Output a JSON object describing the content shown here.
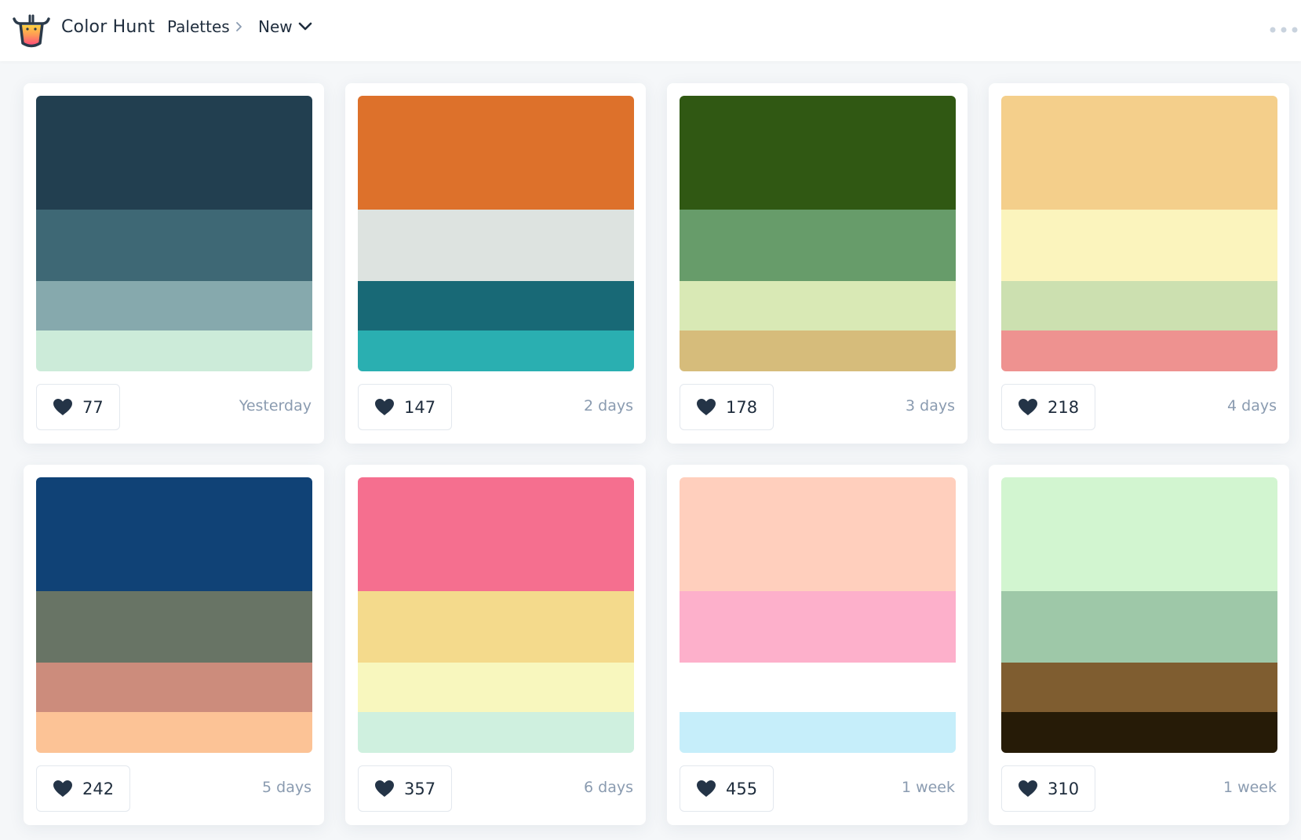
{
  "header": {
    "brand": "Color Hunt",
    "breadcrumb": "Palettes",
    "sort": "New"
  },
  "palettes": [
    {
      "colors": [
        "#223f50",
        "#3e6875",
        "#86a9ad",
        "#ccebd9"
      ],
      "likes": "77",
      "date": "Yesterday"
    },
    {
      "colors": [
        "#dd712b",
        "#dde3e0",
        "#186976",
        "#2aafb1"
      ],
      "likes": "147",
      "date": "2 days"
    },
    {
      "colors": [
        "#305813",
        "#679c6a",
        "#d9e9b5",
        "#d6bc7b"
      ],
      "likes": "178",
      "date": "3 days"
    },
    {
      "colors": [
        "#f4cf8b",
        "#fbf4bd",
        "#cce0b0",
        "#ee9290"
      ],
      "likes": "218",
      "date": "4 days"
    },
    {
      "colors": [
        "#104276",
        "#687465",
        "#cc8c7c",
        "#fcc396"
      ],
      "likes": "242",
      "date": "5 days"
    },
    {
      "colors": [
        "#f56f8f",
        "#f4da8c",
        "#f8f7be",
        "#cff0df"
      ],
      "likes": "357",
      "date": "6 days"
    },
    {
      "colors": [
        "#ffcfbd",
        "#fdb0cb",
        "#ffffff",
        "#c6eefa"
      ],
      "likes": "455",
      "date": "1 week"
    },
    {
      "colors": [
        "#d2f5d0",
        "#9ec8a8",
        "#7f5d30",
        "#261b07"
      ],
      "likes": "310",
      "date": "1 week"
    }
  ]
}
